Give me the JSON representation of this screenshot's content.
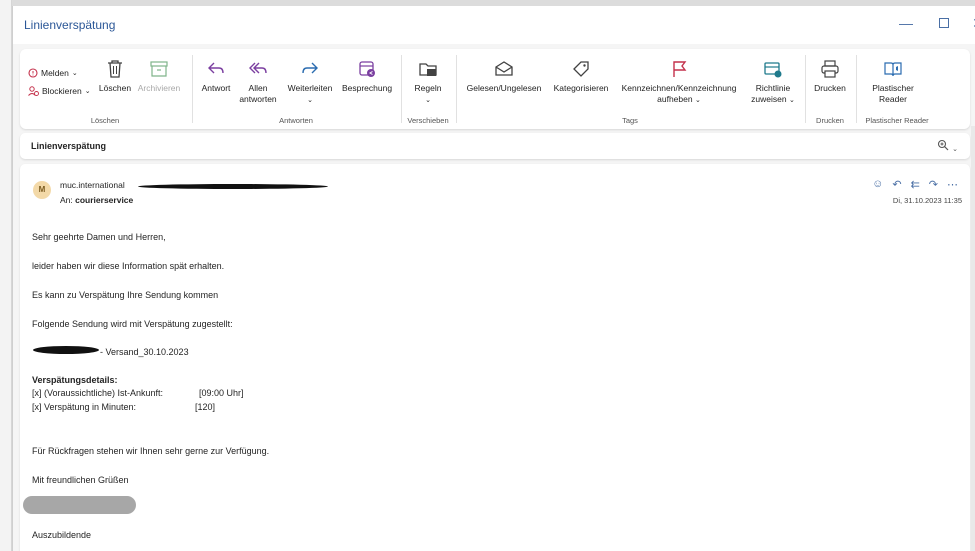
{
  "window": {
    "title": "Linienverspätung",
    "minimize_icon": "minimize-icon",
    "maximize_icon": "maximize-icon",
    "close_icon": "close-icon"
  },
  "ribbon": {
    "groups": {
      "loeschen": {
        "label": "Löschen",
        "melden": "Melden",
        "blockieren": "Blockieren",
        "loeschen_btn": "Löschen",
        "archivieren": "Archivieren"
      },
      "antworten": {
        "label": "Antworten",
        "antwort": "Antwort",
        "allen1": "Allen",
        "allen2": "antworten",
        "weiterleiten": "Weiterleiten",
        "besprechung": "Besprechung"
      },
      "verschieben": {
        "label": "Verschieben",
        "regeln": "Regeln"
      },
      "tags": {
        "label": "Tags",
        "gelesen": "Gelesen/Ungelesen",
        "kategorisieren": "Kategorisieren",
        "kennzeichnen1": "Kennzeichnen/Kennzeichnung",
        "kennzeichnen2": "aufheben",
        "richtlinie1": "Richtlinie",
        "richtlinie2": "zuweisen"
      },
      "drucken": {
        "label": "Drucken",
        "drucken_btn": "Drucken"
      },
      "reader": {
        "label": "Plastischer Reader",
        "btn1": "Plastischer",
        "btn2": "Reader"
      }
    }
  },
  "subject_bar": {
    "subject": "Linienverspätung"
  },
  "message": {
    "avatar_initial": "M",
    "from": "muc.international",
    "to_label": "An:",
    "to_value": "courierservice",
    "date": "Di, 31.10.2023 11:35",
    "body": {
      "greeting": "Sehr geehrte Damen und Herren,",
      "line1": "leider haben wir diese Information spät erhalten.",
      "line2": "Es kann zu Verspätung Ihre Sendung kommen",
      "line3": "Folgende Sendung wird mit Verspätung zugestellt:",
      "shipment": "- Versand_30.10.2023",
      "details_heading": "Verspätungsdetails:",
      "detail1_label": "[x] (Voraussichtliche) Ist-Ankunft:",
      "detail1_value": "[09:00 Uhr]",
      "detail2_label": "[x] Verspätung in Minuten:",
      "detail2_value": "[120]",
      "questions": "Für Rückfragen stehen wir Ihnen sehr gerne zur Verfügung.",
      "closing": "Mit freundlichen Grüßen",
      "role": "Auszubildende"
    }
  },
  "colors": {
    "accent": "#2b5797",
    "icon_purple": "#7b3fa0",
    "icon_teal": "#1f7a8c",
    "flag_red": "#c4314b"
  }
}
